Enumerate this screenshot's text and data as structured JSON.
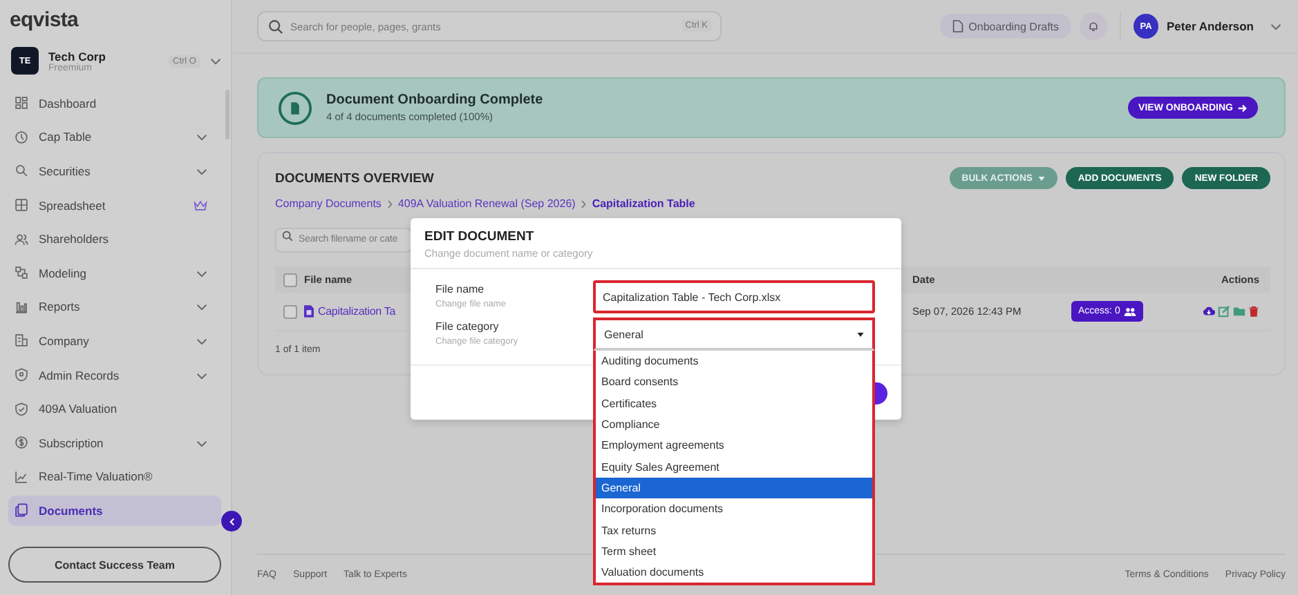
{
  "brand": {
    "logo": "eqvista"
  },
  "company": {
    "initials": "TE",
    "name": "Tech Corp",
    "plan": "Freemium",
    "shortcut": "Ctrl O"
  },
  "sidebar": {
    "items": [
      {
        "label": "Dashboard",
        "expandable": false,
        "premium": false,
        "selected": false
      },
      {
        "label": "Cap Table",
        "expandable": true,
        "premium": false,
        "selected": false
      },
      {
        "label": "Securities",
        "expandable": true,
        "premium": false,
        "selected": false
      },
      {
        "label": "Spreadsheet",
        "expandable": false,
        "premium": true,
        "selected": false
      },
      {
        "label": "Shareholders",
        "expandable": false,
        "premium": false,
        "selected": false
      },
      {
        "label": "Modeling",
        "expandable": true,
        "premium": false,
        "selected": false
      },
      {
        "label": "Reports",
        "expandable": true,
        "premium": false,
        "selected": false
      },
      {
        "label": "Company",
        "expandable": true,
        "premium": false,
        "selected": false
      },
      {
        "label": "Admin Records",
        "expandable": true,
        "premium": false,
        "selected": false
      },
      {
        "label": "409A Valuation",
        "expandable": false,
        "premium": false,
        "selected": false
      },
      {
        "label": "Subscription",
        "expandable": true,
        "premium": false,
        "selected": false
      },
      {
        "label": "Real-Time Valuation®",
        "expandable": false,
        "premium": false,
        "selected": false
      },
      {
        "label": "Documents",
        "expandable": false,
        "premium": false,
        "selected": true
      }
    ],
    "contact_button": "Contact Success Team"
  },
  "topbar": {
    "search": {
      "placeholder": "Search for people, pages, grants",
      "shortcut": "Ctrl K"
    },
    "drafts_button": "Onboarding Drafts",
    "user": {
      "initials": "PA",
      "name": "Peter Anderson"
    }
  },
  "banner": {
    "title": "Document Onboarding Complete",
    "subtitle": "4 of 4 documents completed (100%)",
    "button": "VIEW ONBOARDING"
  },
  "documents": {
    "title": "DOCUMENTS OVERVIEW",
    "buttons": [
      {
        "label": "BULK ACTIONS",
        "kind": "dropdown"
      },
      {
        "label": "ADD DOCUMENTS",
        "kind": "primary"
      },
      {
        "label": "NEW FOLDER",
        "kind": "primary"
      }
    ],
    "breadcrumb": [
      "Company Documents",
      "409A Valuation Renewal (Sep 2026)",
      "Capitalization Table"
    ],
    "search": {
      "placeholder": "Search filename or cate"
    },
    "table": {
      "header_checked": false,
      "columns": [
        "File name",
        "Date",
        "Actions"
      ],
      "rows": [
        {
          "checked": false,
          "file_name": "Capitalization Ta",
          "date": "Sep 07, 2026 12:43 PM",
          "access": "Access: 0"
        }
      ]
    },
    "count": "1 of 1 item"
  },
  "footer": {
    "links": [
      "FAQ",
      "Support",
      "Talk to Experts"
    ],
    "legal": [
      "Terms & Conditions",
      "Privacy Policy"
    ]
  },
  "modal": {
    "title": "EDIT DOCUMENT",
    "subtitle": "Change document name or category",
    "fields": [
      {
        "label": "File name",
        "hint": "Change file name",
        "kind": "text",
        "value": "Capitalization Table - Tech Corp.xlsx"
      },
      {
        "label": "File category",
        "hint": "Change file category",
        "kind": "select",
        "value": "General",
        "expanded": true,
        "options": [
          {
            "label": "Auditing documents",
            "selected": false
          },
          {
            "label": "Board consents",
            "selected": false
          },
          {
            "label": "Certificates",
            "selected": false
          },
          {
            "label": "Compliance",
            "selected": false
          },
          {
            "label": "Employment agreements",
            "selected": false
          },
          {
            "label": "Equity Sales Agreement",
            "selected": false
          },
          {
            "label": "General",
            "selected": true
          },
          {
            "label": "Incorporation documents",
            "selected": false
          },
          {
            "label": "Tax returns",
            "selected": false
          },
          {
            "label": "Term sheet",
            "selected": false
          },
          {
            "label": "Valuation documents",
            "selected": false
          }
        ]
      }
    ]
  }
}
